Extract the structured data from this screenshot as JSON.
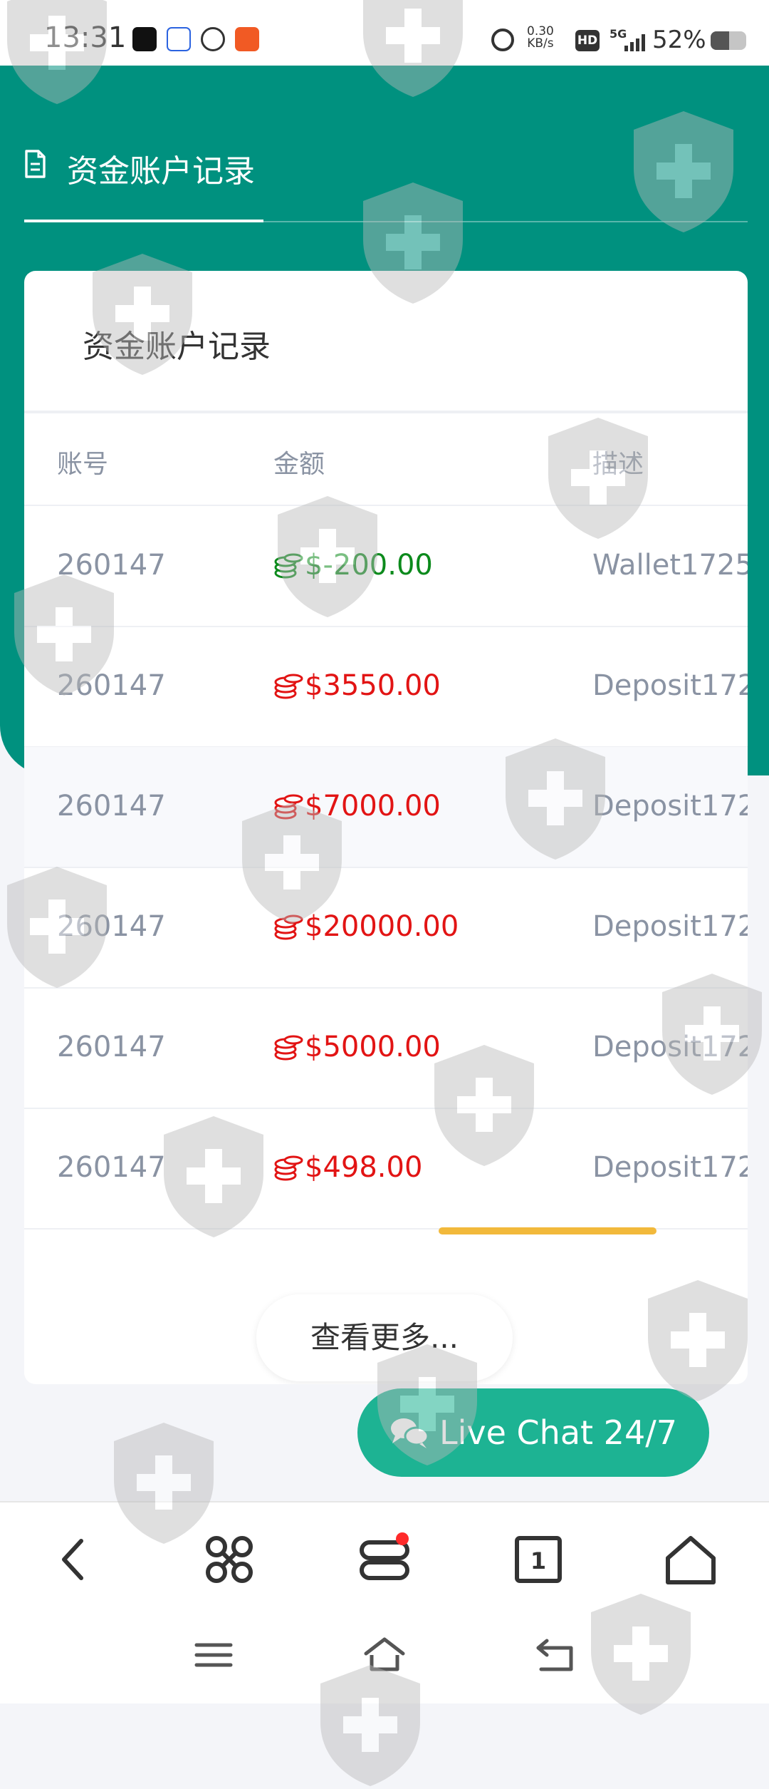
{
  "status_bar": {
    "time": "13:31",
    "net_speed_value": "0.30",
    "net_speed_unit": "KB/s",
    "hd_label": "HD",
    "signal_label": "5G",
    "battery_percent": "52%",
    "battery_level": 0.52
  },
  "header": {
    "title": "资金账户记录"
  },
  "card": {
    "title": "资金账户记录",
    "columns": {
      "account": "账号",
      "amount": "金额",
      "description": "描述"
    },
    "rows": [
      {
        "account": "260147",
        "amount": "$-200.00",
        "description": "Wallet1725",
        "color": "#0c8a1c"
      },
      {
        "account": "260147",
        "amount": "$3550.00",
        "description": "Deposit172",
        "color": "#e21414"
      },
      {
        "account": "260147",
        "amount": "$7000.00",
        "description": "Deposit172",
        "color": "#e21414"
      },
      {
        "account": "260147",
        "amount": "$20000.00",
        "description": "Deposit172",
        "color": "#e21414"
      },
      {
        "account": "260147",
        "amount": "$5000.00",
        "description": "Deposit172",
        "color": "#e21414"
      },
      {
        "account": "260147",
        "amount": "$498.00",
        "description": "Deposit172",
        "color": "#e21414"
      }
    ],
    "more_button": "查看更多..."
  },
  "live_chat": {
    "label": "Live Chat 24/7"
  },
  "nav": {
    "items": [
      "back-icon",
      "command-icon",
      "stack-icon",
      "tab-count-icon",
      "home-icon"
    ],
    "tab_count": "1"
  },
  "system_nav": [
    "menu-icon",
    "home-outline-icon",
    "return-icon"
  ],
  "colors": {
    "teal": "#00917f",
    "live_chat": "#1db393",
    "scroll_indicator": "#f2b93b",
    "negative_amount": "#0c8a1c",
    "positive_amount": "#e21414"
  }
}
